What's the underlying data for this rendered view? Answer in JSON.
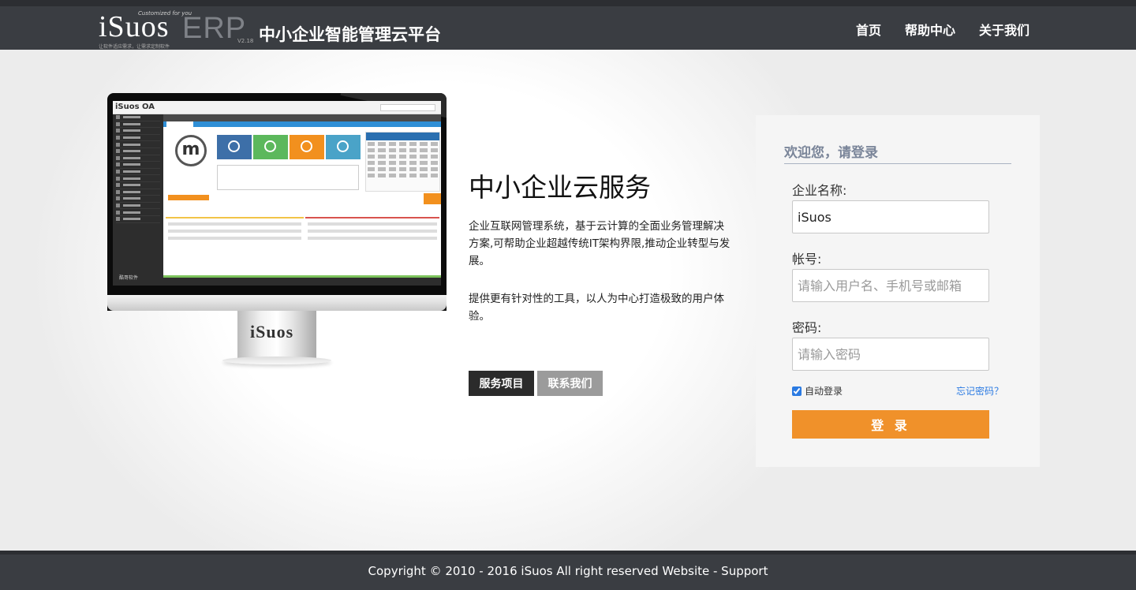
{
  "header": {
    "logo_text": "iSuos",
    "logo_tagline": "Customized for you",
    "logo_slogan": "让软件适应需求，让需求定制软件",
    "logo_product": "ERP",
    "logo_version": "V2.18",
    "platform_title": "中小企业智能管理云平台",
    "nav": [
      "首页",
      "帮助中心",
      "关于我们"
    ]
  },
  "monitor": {
    "app_name": "iSuos OA",
    "avatar_letter": "m",
    "brand": "iSuos",
    "footer_text": "酷哥软件"
  },
  "intro": {
    "title": "中小企业云服务",
    "paragraph1": "企业互联网管理系统，基于云计算的全面业务管理解决方案,可帮助企业超越传统IT架构界限,推动企业转型与发展。",
    "paragraph2": "提供更有针对性的工具，以人为中心打造极致的用户体验。",
    "btn_services": "服务项目",
    "btn_contact": "联系我们"
  },
  "login": {
    "title": "欢迎您，请登录",
    "company_label": "企业名称:",
    "company_value": "iSuos",
    "account_label": "帐号:",
    "account_placeholder": "请输入用户名、手机号或邮箱",
    "password_label": "密码:",
    "password_placeholder": "请输入密码",
    "remember_label": "自动登录",
    "remember_checked": true,
    "forgot_label": "忘记密码？",
    "submit_label": "登 录"
  },
  "footer": {
    "copyright": "Copyright © 2010 - 2016 iSuos All right reserved ",
    "website_link": "Website",
    "separator": " - ",
    "support_link": "Support"
  },
  "colors": {
    "header_bg": "#3a3d42",
    "accent_orange": "#f0912a",
    "link_blue": "#2a7ae2"
  }
}
